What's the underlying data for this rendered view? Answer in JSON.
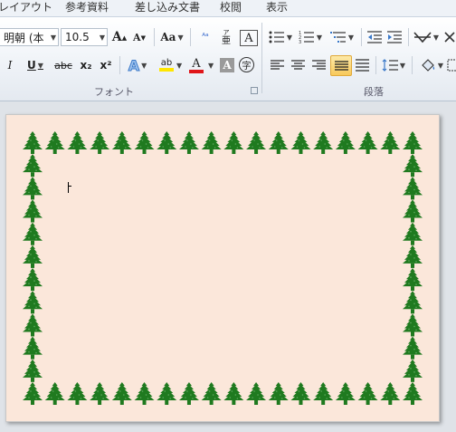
{
  "tabs": [
    "レイアウト",
    "参考資料",
    "差し込み文書",
    "校閲",
    "表示"
  ],
  "font": {
    "name_value": "明朝 (本",
    "size_value": "10.5",
    "grow_label": "A",
    "shrink_label": "A",
    "case_label": "Aa",
    "italic_label": "I",
    "underline_label": "U",
    "strike_label": "abc",
    "subscript_label": "x₂",
    "superscript_label": "x²",
    "effects_label": "A",
    "highlight_label": "ab",
    "color_label": "A",
    "shading_label": "A",
    "enclose_label": "字",
    "border_label": "A",
    "ruby_label": "亜",
    "group_label": "フォント"
  },
  "paragraph": {
    "group_label": "段落"
  },
  "icons": {
    "bullets": "bullets-icon",
    "numbering": "numbering-icon",
    "multilevel": "multilevel-list-icon",
    "decrease_indent": "decrease-indent-icon",
    "increase_indent": "increase-indent-icon",
    "sort": "sort-icon",
    "align_left": "align-left-icon",
    "center": "align-center-icon",
    "align_right": "align-right-icon",
    "justify": "justify-icon",
    "distributed": "distributed-icon",
    "line_spacing": "line-spacing-icon",
    "shading": "paint-bucket-icon",
    "border": "border-icon",
    "tree": "christmas-tree-icon"
  },
  "colors": {
    "page_bg": "#fbe7da",
    "tree_green": "#1f7a1f",
    "highlight_yellow": "#ffe600",
    "font_color_red": "#e0161a",
    "active_button": "#f8c95a"
  }
}
